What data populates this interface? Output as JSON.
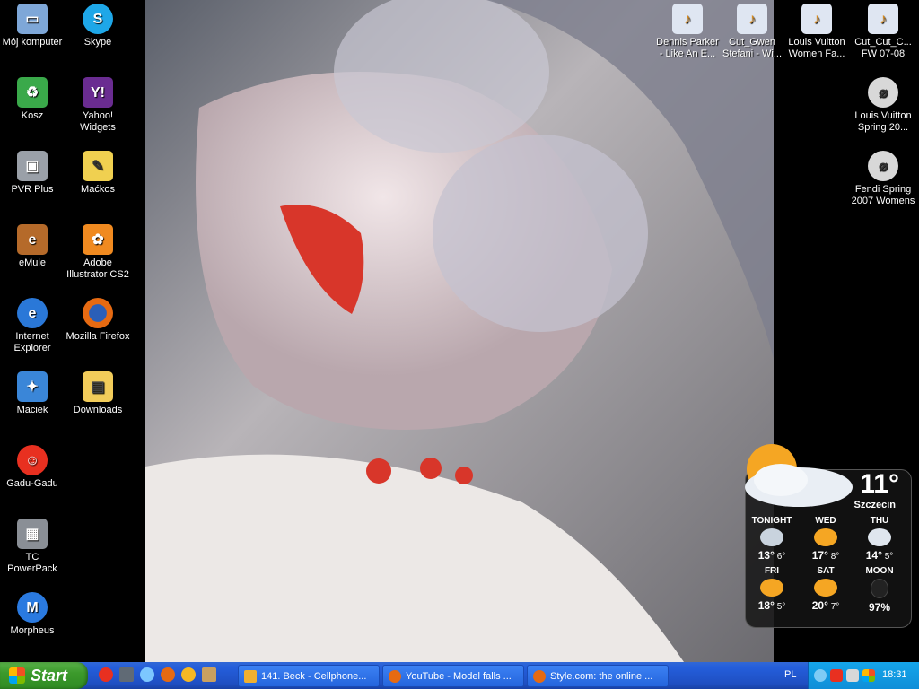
{
  "desktop_left": [
    {
      "label": "Mój komputer",
      "icon": "computer-icon",
      "color": "#7ea7d8"
    },
    {
      "label": "Skype",
      "icon": "skype-icon",
      "color": "#1ea7e8"
    },
    {
      "label": "Kosz",
      "icon": "recycle-bin-icon",
      "color": "#3aa94a"
    },
    {
      "label": "Yahoo! Widgets",
      "icon": "yahoo-widgets-icon",
      "color": "#6a2c91"
    },
    {
      "label": "PVR Plus",
      "icon": "pvr-icon",
      "color": "#9aa0a8"
    },
    {
      "label": "Maćkos",
      "icon": "document-icon",
      "color": "#f0d050"
    },
    {
      "label": "eMule",
      "icon": "emule-icon",
      "color": "#b56a2a"
    },
    {
      "label": "Adobe Illustrator CS2",
      "icon": "illustrator-icon",
      "color": "#f08a20"
    },
    {
      "label": "Internet Explorer",
      "icon": "ie-icon",
      "color": "#2a78d8"
    },
    {
      "label": "Mozilla Firefox",
      "icon": "firefox-icon",
      "color": "#e66a12"
    },
    {
      "label": "Maciek",
      "icon": "msn-icon",
      "color": "#3a86d8"
    },
    {
      "label": "Downloads",
      "icon": "folder-icon",
      "color": "#f2cc5a"
    },
    {
      "label": "Gadu-Gadu",
      "icon": "gadu-icon",
      "color": "#e83020"
    },
    {
      "label": "TC PowerPack",
      "icon": "powerpack-icon",
      "color": "#8a8f96"
    },
    {
      "label": "Morpheus",
      "icon": "morpheus-icon",
      "color": "#2a7ae0"
    }
  ],
  "desktop_right": [
    {
      "label": "Dennis Parker - Like An E...",
      "icon": "playlist-icon"
    },
    {
      "label": "Cut_Gwen Stefani - Wi...",
      "icon": "playlist-icon"
    },
    {
      "label": "Louis Vuitton Women Fa...",
      "icon": "playlist-icon"
    },
    {
      "label": "Cut_Cut_C... FW 07-08",
      "icon": "playlist-icon"
    },
    {
      "label": "Louis Vuitton Spring 20...",
      "icon": "media-icon"
    },
    {
      "label": "Fendi Spring 2007 Womens",
      "icon": "media-icon"
    }
  ],
  "weather": {
    "temp": "11°",
    "city": "Szczecin",
    "days": [
      {
        "name": "TONIGHT",
        "hi": "13°",
        "lo": "6°"
      },
      {
        "name": "WED",
        "hi": "17°",
        "lo": "8°"
      },
      {
        "name": "THU",
        "hi": "14°",
        "lo": "5°"
      },
      {
        "name": "FRI",
        "hi": "18°",
        "lo": "5°"
      },
      {
        "name": "SAT",
        "hi": "20°",
        "lo": "7°"
      },
      {
        "name": "MOON",
        "hi": "97%",
        "lo": ""
      }
    ]
  },
  "taskbar": {
    "start_label": "Start",
    "tasks": [
      {
        "label": "141. Beck - Cellphone...",
        "icon": "winamp-icon"
      },
      {
        "label": "YouTube - Model falls ...",
        "icon": "firefox-icon"
      },
      {
        "label": "Style.com: the online ...",
        "icon": "firefox-icon"
      }
    ],
    "language": "PL",
    "clock": "18:31"
  },
  "colors": {
    "taskbar_blue": "#245edb",
    "start_green": "#3c9a2c",
    "tray_blue": "#0f8ed8"
  }
}
